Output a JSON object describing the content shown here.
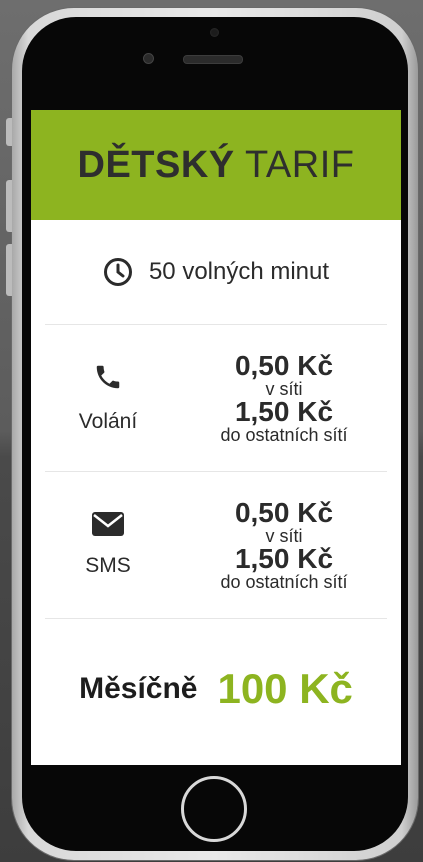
{
  "header": {
    "title_bold": "DĚTSKÝ",
    "title_light": "TARIF"
  },
  "minutes": {
    "icon": "clock-icon",
    "text": "50 volných minut"
  },
  "rows": [
    {
      "icon": "phone-icon",
      "label": "Volání",
      "price_in": "0,50 Kč",
      "in_label": "v síti",
      "price_out": "1,50 Kč",
      "out_label": "do ostatních sítí"
    },
    {
      "icon": "envelope-icon",
      "label": "SMS",
      "price_in": "0,50 Kč",
      "in_label": "v síti",
      "price_out": "1,50 Kč",
      "out_label": "do ostatních sítí"
    }
  ],
  "total": {
    "label": "Měsíčně",
    "price": "100 Kč"
  },
  "colors": {
    "accent": "#8db420",
    "text": "#2b2b2b"
  }
}
